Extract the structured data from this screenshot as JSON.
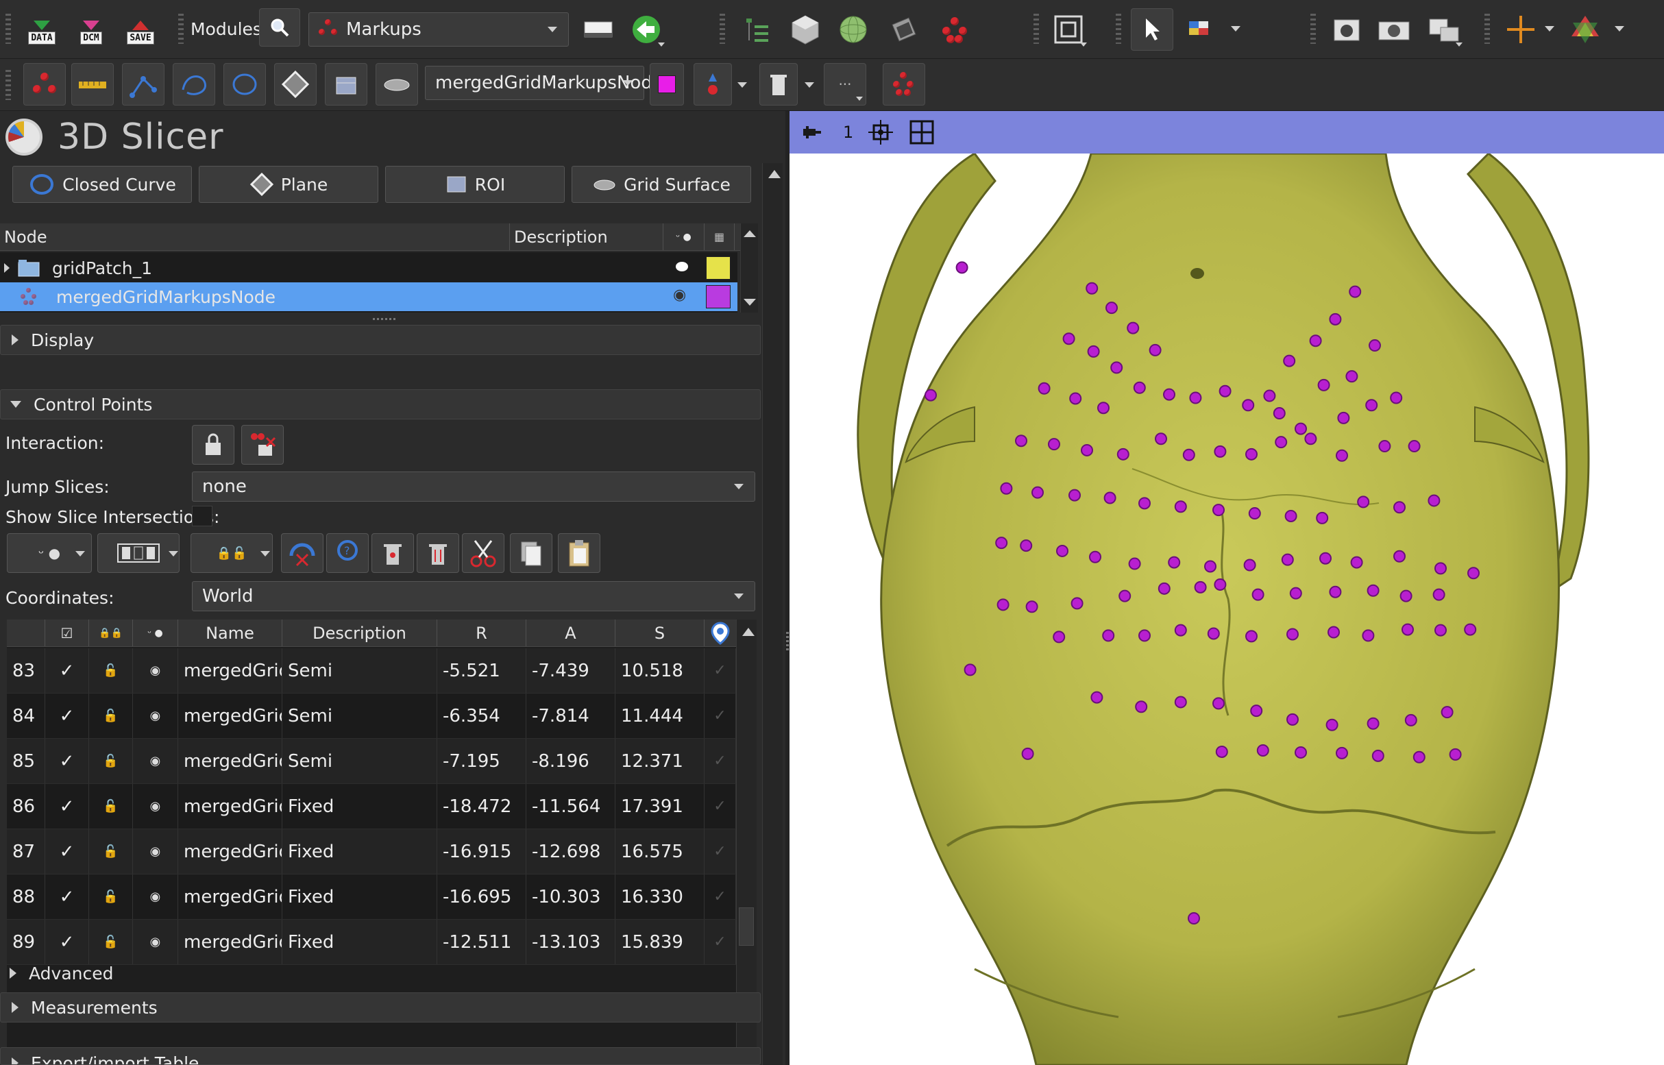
{
  "toolbar1": {
    "file_buttons": [
      "DATA",
      "DCM",
      "SAVE"
    ],
    "modules_label": "Modules:",
    "module_selected": "Markups",
    "icons": [
      "search-icon",
      "layout-icon",
      "back-arrow-icon",
      "data-tree-icon",
      "volume-cube-icon",
      "sphere-icon",
      "slice-icon",
      "markup-cluster-icon",
      "view-icon",
      "pointer-icon",
      "color-mode-icon",
      "screenshot-icon",
      "camera-icon",
      "scene-icon",
      "crosshair-icon",
      "axes-icon"
    ]
  },
  "toolbar2": {
    "node_selected": "mergedGridMarkupsNode",
    "accent_color": "#e81ee8"
  },
  "app": {
    "title": "3D Slicer"
  },
  "create_buttons": [
    {
      "label": "Closed Curve"
    },
    {
      "label": "Plane"
    },
    {
      "label": "ROI"
    },
    {
      "label": "Grid Surface"
    }
  ],
  "node_table": {
    "col_node": "Node",
    "col_description": "Description",
    "rows": [
      {
        "name": "gridPatch_1",
        "color": "#e6e24a",
        "type": "folder"
      },
      {
        "name": "mergedGridMarkupsNode",
        "color": "#b93be0",
        "type": "markup",
        "selected": true
      }
    ]
  },
  "sections": {
    "display": "Display",
    "control_points": "Control Points",
    "advanced": "Advanced",
    "measurements": "Measurements",
    "export": "Export/import Table"
  },
  "control_points": {
    "interaction_label": "Interaction:",
    "jump_slices_label": "Jump Slices:",
    "jump_slices_value": "none",
    "show_slice_label": "Show Slice Intersections:",
    "coordinates_label": "Coordinates:",
    "coordinates_value": "World",
    "table": {
      "headers": [
        "Name",
        "Description",
        "R",
        "A",
        "S"
      ],
      "rows": [
        {
          "idx": "83",
          "check": "✓",
          "name": "mergedGrid...",
          "desc": "Semi",
          "r": "-5.521",
          "a": "-7.439",
          "s": "10.518"
        },
        {
          "idx": "84",
          "check": "✓",
          "name": "mergedGrid...",
          "desc": "Semi",
          "r": "-6.354",
          "a": "-7.814",
          "s": "11.444"
        },
        {
          "idx": "85",
          "check": "✓",
          "name": "mergedGrid...",
          "desc": "Semi",
          "r": "-7.195",
          "a": "-8.196",
          "s": "12.371"
        },
        {
          "idx": "86",
          "check": "✓",
          "name": "mergedGrid...",
          "desc": "Fixed",
          "r": "-18.472",
          "a": "-11.564",
          "s": "17.391"
        },
        {
          "idx": "87",
          "check": "✓",
          "name": "mergedGrid...",
          "desc": "Fixed",
          "r": "-16.915",
          "a": "-12.698",
          "s": "16.575"
        },
        {
          "idx": "88",
          "check": "✓",
          "name": "mergedGrid...",
          "desc": "Fixed",
          "r": "-16.695",
          "a": "-10.303",
          "s": "16.330"
        },
        {
          "idx": "89",
          "check": "✓",
          "name": "mergedGrid...",
          "desc": "Fixed",
          "r": "-12.511",
          "a": "-13.103",
          "s": "15.839"
        }
      ]
    }
  },
  "view3d": {
    "view_number": "1",
    "bar_color": "#7c84dc",
    "model_color": "#b8b84a",
    "point_color": "#b81fd0"
  }
}
